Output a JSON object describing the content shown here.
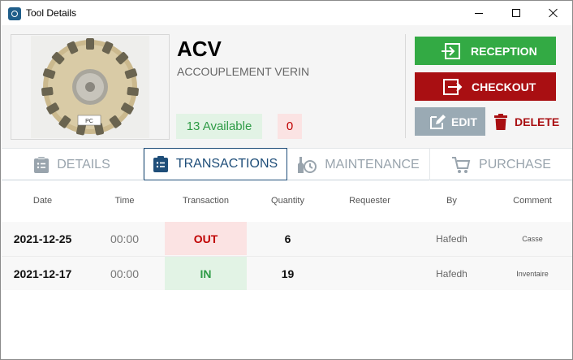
{
  "window": {
    "title": "Tool Details"
  },
  "tool": {
    "code": "ACV",
    "description": "ACCOUPLEMENT VERIN",
    "available": "13 Available",
    "out_count": "0",
    "photo_label": "PC"
  },
  "actions": {
    "reception": "RECEPTION",
    "checkout": "CHECKOUT",
    "edit": "EDIT",
    "delete": "DELETE"
  },
  "tabs": [
    {
      "label": "DETAILS",
      "icon": "clipboard-list-icon"
    },
    {
      "label": "TRANSACTIONS",
      "icon": "clipboard-list-icon"
    },
    {
      "label": "MAINTENANCE",
      "icon": "tools-clock-icon"
    },
    {
      "label": "PURCHASE",
      "icon": "cart-icon"
    }
  ],
  "table": {
    "headers": [
      "Date",
      "Time",
      "Transaction",
      "Quantity",
      "Requester",
      "By",
      "Comment"
    ],
    "rows": [
      {
        "date": "2021-12-25",
        "time": "00:00",
        "transaction": "OUT",
        "quantity": "6",
        "requester": "",
        "by": "Hafedh",
        "comment": "Casse"
      },
      {
        "date": "2021-12-17",
        "time": "00:00",
        "transaction": "IN",
        "quantity": "19",
        "requester": "",
        "by": "Hafedh",
        "comment": "Inventaire"
      }
    ]
  },
  "colors": {
    "reception": "#33aa44",
    "checkout": "#a90f12",
    "edit": "#9aaab4",
    "active_tab": "#1f4e79"
  }
}
